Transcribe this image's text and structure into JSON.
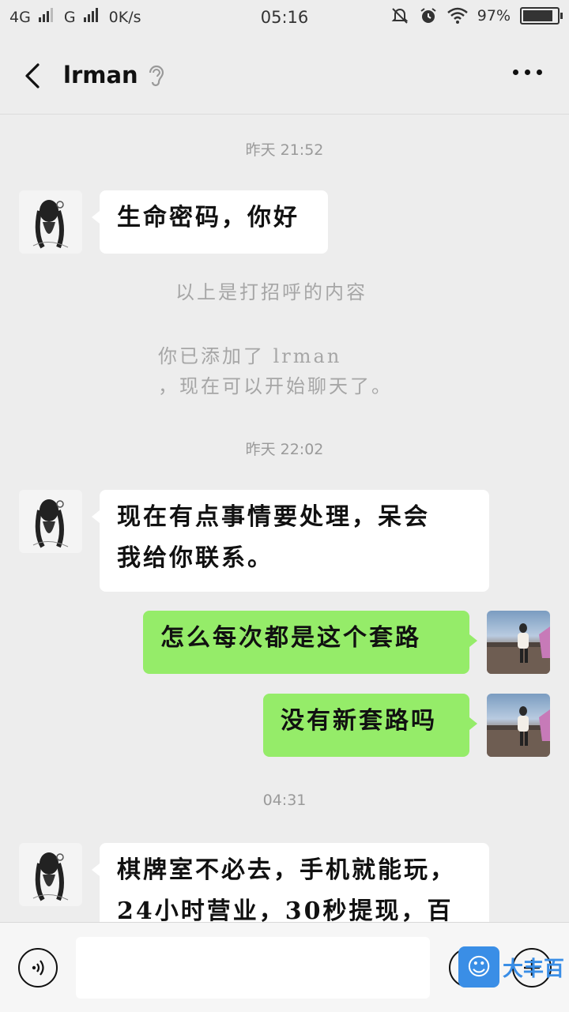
{
  "status_bar": {
    "network1": "4G",
    "network2": "G",
    "speed": "0K/s",
    "time": "05:16",
    "battery": "97%",
    "battery_level": 0.97
  },
  "header": {
    "title": "lrman"
  },
  "messages": {
    "ts1": "昨天 21:52",
    "m1": "生命密码，你好",
    "sys1": "以上是打招呼的内容",
    "sys2_line1": "你已添加了 lrman",
    "sys2_line2": "，现在可以开始聊天了。",
    "ts2": "昨天 22:02",
    "m2_line1": "现在有点事情要处理，呆会",
    "m2_line2": "我给你联系。",
    "m3": "怎么每次都是这个套路",
    "m4": "没有新套路吗",
    "ts3": "04:31",
    "m5_line1": "棋牌室不必去，手机就能玩，",
    "m5_line2": "24小时营业，30秒提现，百"
  },
  "input": {
    "value": ""
  },
  "watermark": {
    "text": "大丰百"
  },
  "icons": {
    "back": "chevron-left-icon",
    "ear": "ear-icon",
    "more": "more-icon",
    "voice": "voice-icon",
    "emoji": "emoji-icon",
    "plus": "plus-icon"
  }
}
